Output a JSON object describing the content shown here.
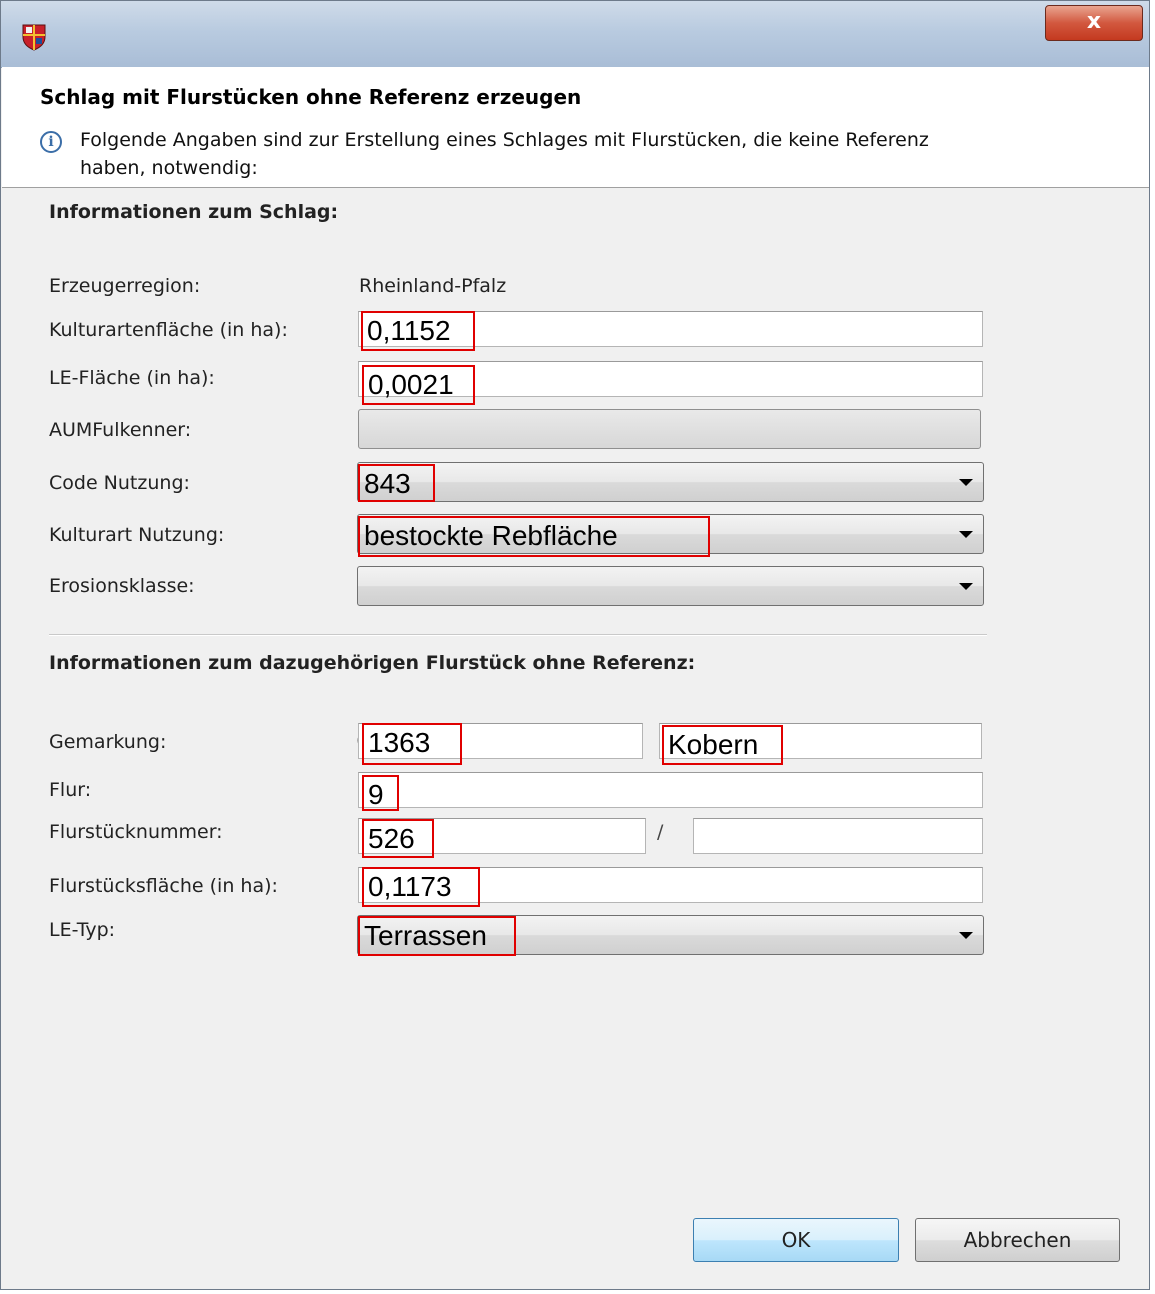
{
  "window": {
    "close_symbol": "x",
    "icon": "coat-of-arms-icon"
  },
  "banner": {
    "heading": "Schlag mit Flurstücken ohne Referenz erzeugen",
    "info_symbol": "i",
    "message": "Folgende Angaben sind zur Erstellung eines Schlages mit Flurstücken, die keine Referenz haben, notwendig:"
  },
  "schlag": {
    "title": "Informationen zum Schlag:",
    "erzeugerregion_label": "Erzeugerregion:",
    "erzeugerregion_value": "Rheinland-Pfalz",
    "kulturartenflaeche_label": "Kulturartenfläche (in ha):",
    "kulturartenflaeche_value": "0,1152",
    "le_flaeche_label": "LE-Fläche (in ha):",
    "le_flaeche_value": "0,0021",
    "aumfulkenner_label": "AUMFulkenner:",
    "code_nutzung_label": "Code Nutzung:",
    "code_nutzung_value": "843",
    "kulturart_nutzung_label": "Kulturart Nutzung:",
    "kulturart_nutzung_value": "bestockte Rebfläche",
    "erosionsklasse_label": "Erosionsklasse:"
  },
  "flurstueck": {
    "title": "Informationen zum dazugehörigen Flurstück ohne Referenz:",
    "gemarkung_label": "Gemarkung:",
    "gemarkung_code": "1363",
    "gemarkung_name": "Kobern",
    "flur_label": "Flur:",
    "flur_value": "9",
    "flurstuecknummer_label": "Flurstücknummer:",
    "flurstuecknummer_value": "526",
    "slash": "/",
    "flurstuecksflaeche_label": "Flurstücksfläche (in ha):",
    "flurstuecksflaeche_value": "0,1173",
    "le_typ_label": "LE-Typ:",
    "le_typ_value": "Terrassen"
  },
  "buttons": {
    "ok": "OK",
    "cancel": "Abbrechen"
  },
  "colors": {
    "highlight_border": "#e00000",
    "titlebar": "#b9cbe0",
    "close": "#c4391f"
  }
}
